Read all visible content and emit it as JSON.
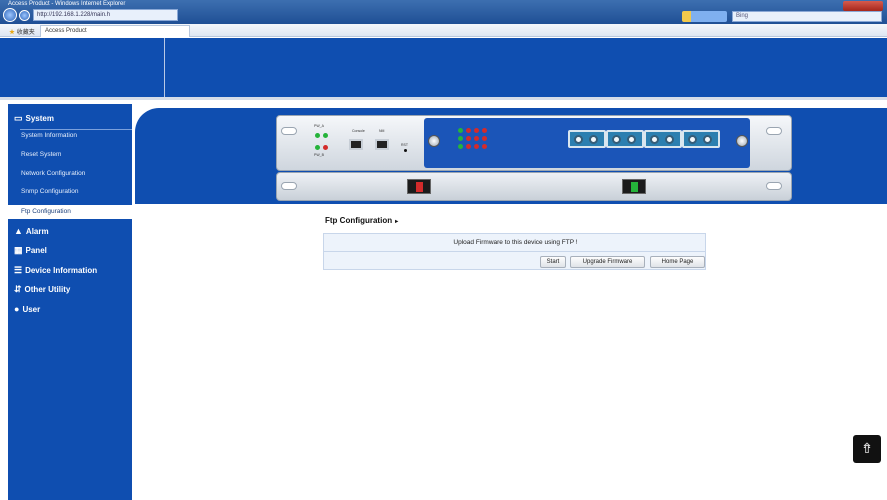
{
  "browser": {
    "window_title": "Access Product - Windows Internet Explorer",
    "address": "http://192.168.1.228/main.h",
    "search_placeholder": "Bing",
    "favorites_label": "收藏夹",
    "tab_label": "Access Product"
  },
  "sidebar": {
    "sections": [
      {
        "icon": "monitor-icon",
        "label": "System"
      },
      {
        "icon": "warning-icon",
        "label": "Alarm"
      },
      {
        "icon": "panel-icon",
        "label": "Panel"
      },
      {
        "icon": "list-icon",
        "label": "Device Information"
      },
      {
        "icon": "utility-icon",
        "label": "Other Utility"
      },
      {
        "icon": "user-icon",
        "label": "User"
      }
    ],
    "system_items": [
      "System Information",
      "Reset System",
      "Network Configuration",
      "Snmp Configuration",
      "Ftp Configuration"
    ],
    "active_item": "Ftp Configuration"
  },
  "device_panel": {
    "labels": {
      "pw_a": "PW_A",
      "pw_b": "PW_B",
      "console": "Console",
      "nm": "NM",
      "rst": "RST"
    }
  },
  "ftp": {
    "title": "Ftp Configuration",
    "message": "Upload Firmware to this device using FTP !",
    "buttons": {
      "start": "Start",
      "upgrade": "Upgrade Firmware",
      "home": "Home Page"
    }
  },
  "colors": {
    "brand_blue": "#0f4eb0",
    "panel_blue": "#1b55b8"
  }
}
